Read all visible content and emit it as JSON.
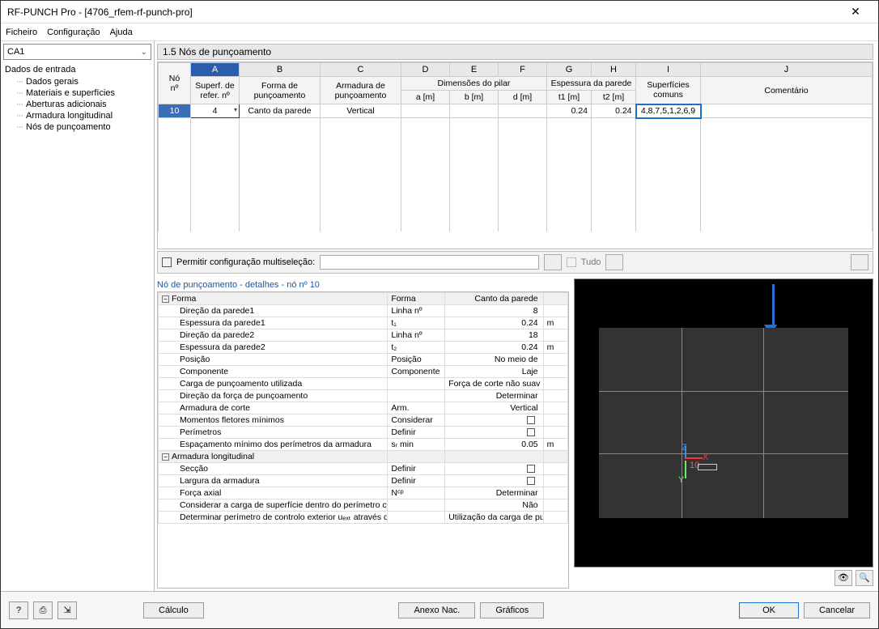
{
  "window": {
    "title": "RF-PUNCH Pro - [4706_rfem-rf-punch-pro]"
  },
  "menu": {
    "file": "Ficheiro",
    "config": "Configuração",
    "help": "Ajuda"
  },
  "sidebar": {
    "case": "CA1",
    "root": "Dados de entrada",
    "items": [
      "Dados gerais",
      "Materiais e superfícies",
      "Aberturas adicionais",
      "Armadura longitudinal",
      "Nós de punçoamento"
    ]
  },
  "section": {
    "title": "1.5 Nós de punçoamento"
  },
  "grid": {
    "letters": [
      "A",
      "B",
      "C",
      "D",
      "E",
      "F",
      "G",
      "H",
      "I",
      "J"
    ],
    "colhead": {
      "no": "Nó\nnº",
      "a": "Superf. de\nrefer. nº",
      "b": "Forma de\npunçoamento",
      "c": "Armadura de\npunçoamento",
      "dim": "Dimensões do pilar",
      "d": "a [m]",
      "e": "b [m]",
      "f": "d [m]",
      "esp": "Espessura da parede",
      "g": "t1 [m]",
      "h": "t2 [m]",
      "i": "Superfícies\ncomuns",
      "j": "Comentário"
    },
    "row": {
      "no": "10",
      "a": "4",
      "b": "Canto da parede",
      "c": "Vertical",
      "d": "",
      "e": "",
      "f": "",
      "g": "0.24",
      "h": "0.24",
      "i": "4,8,7,5,1,2,6,9",
      "j": ""
    }
  },
  "multisel": {
    "label": "Permitir configuração multiseleção:",
    "tudo": "Tudo"
  },
  "details": {
    "title": "Nó de punçoamento - detalhes - nó nº 10",
    "rows": [
      {
        "t": "grp",
        "c1": "Forma",
        "c2": "Forma",
        "c3": "Canto da parede",
        "c4": ""
      },
      {
        "t": "r",
        "c1": "Direção da parede1",
        "c2": "Linha nº",
        "c3": "8",
        "c4": ""
      },
      {
        "t": "r",
        "c1": "Espessura da parede1",
        "c2": "t₁",
        "c3": "0.24",
        "c4": "m"
      },
      {
        "t": "r",
        "c1": "Direção da parede2",
        "c2": "Linha nº",
        "c3": "18",
        "c4": ""
      },
      {
        "t": "r",
        "c1": "Espessura da parede2",
        "c2": "t₂",
        "c3": "0.24",
        "c4": "m"
      },
      {
        "t": "r",
        "c1": "Posição",
        "c2": "Posição",
        "c3": "No meio de",
        "c4": ""
      },
      {
        "t": "r",
        "c1": "Componente",
        "c2": "Componente",
        "c3": "Laje",
        "c4": ""
      },
      {
        "t": "r",
        "c1": "Carga de punçoamento utilizada",
        "c2": "",
        "c3": "Força de corte não suav",
        "c4": ""
      },
      {
        "t": "r",
        "c1": "Direção da força de punçoamento",
        "c2": "",
        "c3": "Determinar",
        "c4": ""
      },
      {
        "t": "r",
        "c1": "Armadura de corte",
        "c2": "Arm.",
        "c3": "Vertical",
        "c4": ""
      },
      {
        "t": "r",
        "c1": "Momentos fletores mínimos",
        "c2": "Considerar",
        "c3": "☐",
        "c4": ""
      },
      {
        "t": "r",
        "c1": "Perímetros",
        "c2": "Definir",
        "c3": "☐",
        "c4": ""
      },
      {
        "t": "r",
        "c1": "Espaçamento mínimo dos perímetros da armadura",
        "c2": "sᵣ min",
        "c3": "0.05",
        "c4": "m"
      },
      {
        "t": "grp",
        "c1": "Armadura longitudinal",
        "c2": "",
        "c3": "",
        "c4": ""
      },
      {
        "t": "r",
        "c1": "Secção",
        "c2": "Definir",
        "c3": "☐",
        "c4": ""
      },
      {
        "t": "r",
        "c1": "Largura da armadura",
        "c2": "Definir",
        "c3": "☐",
        "c4": ""
      },
      {
        "t": "r",
        "c1": "Força axial",
        "c2": "Nᶜᵖ",
        "c3": "Determinar",
        "c4": ""
      },
      {
        "t": "r",
        "c1": "Considerar a carga de superfície dentro do perímetro crítico",
        "c2": "",
        "c3": "Não",
        "c4": ""
      },
      {
        "t": "r",
        "c1": "Determinar perímetro de controlo exterior uₑₓₜ através de",
        "c2": "",
        "c3": "Utilização da carga de pu",
        "c4": ""
      }
    ]
  },
  "preview": {
    "node_label": "10",
    "ax": {
      "x": "X",
      "y": "Y",
      "z": "Z"
    }
  },
  "footer": {
    "calc": "Cálculo",
    "annex": "Anexo Nac.",
    "graphs": "Gráficos",
    "ok": "OK",
    "cancel": "Cancelar"
  }
}
